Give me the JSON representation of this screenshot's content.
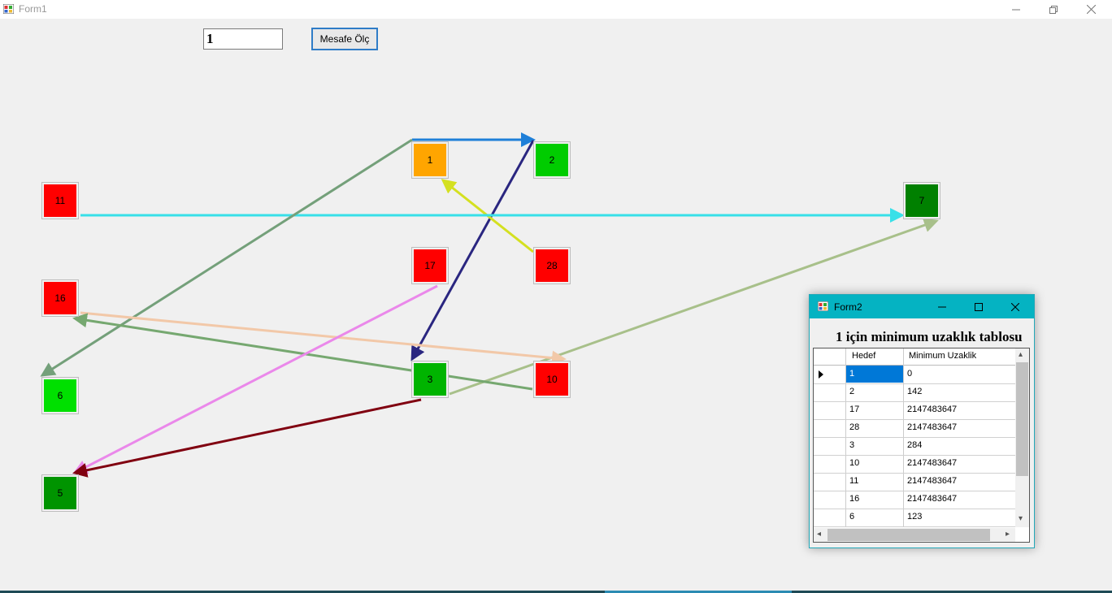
{
  "window": {
    "title": "Form1"
  },
  "toolbar": {
    "source_value": "1",
    "measure_button": "Mesafe Ölç"
  },
  "nodes": [
    {
      "id": "n1",
      "label": "1",
      "color": "#ffa500"
    },
    {
      "id": "n2",
      "label": "2",
      "color": "#00cc00"
    },
    {
      "id": "n7",
      "label": "7",
      "color": "#008000"
    },
    {
      "id": "n11",
      "label": "11",
      "color": "#ff0000"
    },
    {
      "id": "n17",
      "label": "17",
      "color": "#ff0000"
    },
    {
      "id": "n28",
      "label": "28",
      "color": "#ff0000"
    },
    {
      "id": "n16",
      "label": "16",
      "color": "#ff0000"
    },
    {
      "id": "n3",
      "label": "3",
      "color": "#00b400"
    },
    {
      "id": "n10",
      "label": "10",
      "color": "#ff0000"
    },
    {
      "id": "n6",
      "label": "6",
      "color": "#00e000"
    },
    {
      "id": "n5",
      "label": "5",
      "color": "#009400"
    }
  ],
  "edge_colors": [
    "#1e7fd8",
    "#2a2680",
    "#d4e020",
    "#38e0e8",
    "#74a07a",
    "#a8c08a",
    "#f2c8a8",
    "#76a870",
    "#ea88ea",
    "#800010"
  ],
  "form2": {
    "title": "Form2",
    "caption": "1 için minimum uzaklık tablosu",
    "columns": [
      "Hedef",
      "Minimum Uzaklik"
    ],
    "rows": [
      {
        "target": "1",
        "distance": "0"
      },
      {
        "target": "2",
        "distance": "142"
      },
      {
        "target": "17",
        "distance": "2147483647"
      },
      {
        "target": "28",
        "distance": "2147483647"
      },
      {
        "target": "3",
        "distance": "284"
      },
      {
        "target": "10",
        "distance": "2147483647"
      },
      {
        "target": "11",
        "distance": "2147483647"
      },
      {
        "target": "16",
        "distance": "2147483647"
      },
      {
        "target": "6",
        "distance": "123"
      }
    ]
  }
}
